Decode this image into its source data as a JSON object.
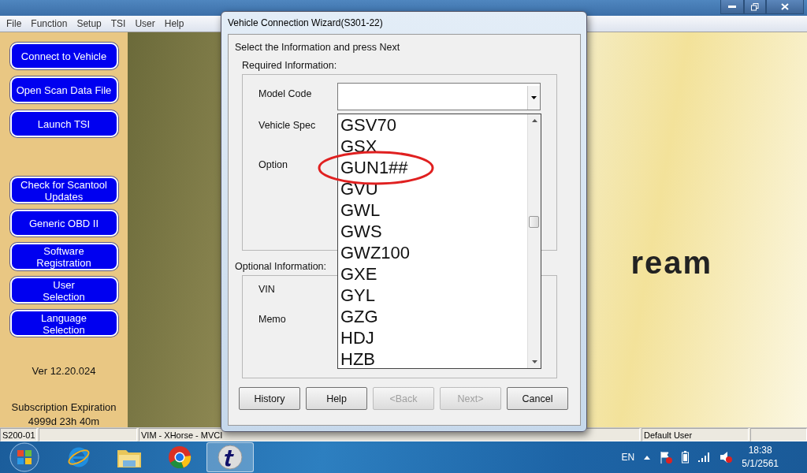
{
  "menu": [
    "File",
    "Function",
    "Setup",
    "TSI",
    "User",
    "Help"
  ],
  "sidebar": {
    "main_buttons": [
      "Connect to Vehicle",
      "Open Scan Data File",
      "Launch TSI"
    ],
    "tool_buttons": [
      "Check for Scantool Updates",
      "Generic OBD II",
      "Software Registration",
      "User\nSelection",
      "Language\nSelection"
    ],
    "version": "Ver 12.20.024",
    "subscription_label": "Subscription Expiration",
    "subscription_remaining": "4999d 23h 40m"
  },
  "background": {
    "logo_text": "ream"
  },
  "dialog": {
    "title": "Vehicle Connection Wizard(S301-22)",
    "instruction": "Select the Information and press Next",
    "required_label": "Required Information:",
    "required_fields": [
      {
        "label": "Model Code"
      },
      {
        "label": "Vehicle Spec"
      },
      {
        "label": "Option"
      }
    ],
    "optional_label": "Optional Information:",
    "optional_fields": [
      {
        "label": "VIN"
      },
      {
        "label": "Memo"
      }
    ],
    "model_code_list": [
      {
        "label": "GSV70",
        "circled": false
      },
      {
        "label": "GSX",
        "circled": false
      },
      {
        "label": "GUN1##",
        "circled": true
      },
      {
        "label": "GVU",
        "circled": false
      },
      {
        "label": "GWL",
        "circled": false
      },
      {
        "label": "GWS",
        "circled": false
      },
      {
        "label": "GWZ100",
        "circled": false
      },
      {
        "label": "GXE",
        "circled": false
      },
      {
        "label": "GYL",
        "circled": false
      },
      {
        "label": "GZG",
        "circled": false
      },
      {
        "label": "HDJ",
        "circled": false
      },
      {
        "label": "HZB",
        "circled": false
      }
    ],
    "buttons": [
      {
        "label": "History",
        "disabled": false
      },
      {
        "label": "Help",
        "disabled": false
      },
      {
        "label": "<Back",
        "disabled": true
      },
      {
        "label": "Next>",
        "disabled": true
      },
      {
        "label": "Cancel",
        "disabled": false
      }
    ]
  },
  "status_bar": {
    "code": "S200-01",
    "connection": "VIM - XHorse - MVCI",
    "user": "Default User"
  },
  "taskbar": {
    "apps": [
      {
        "kind": "browser-e",
        "active": false
      },
      {
        "kind": "folder",
        "active": false
      },
      {
        "kind": "chrome",
        "active": false
      },
      {
        "kind": "t-app",
        "active": true
      }
    ],
    "language": "EN",
    "time": "18:38",
    "date": "5/1/2561"
  }
}
